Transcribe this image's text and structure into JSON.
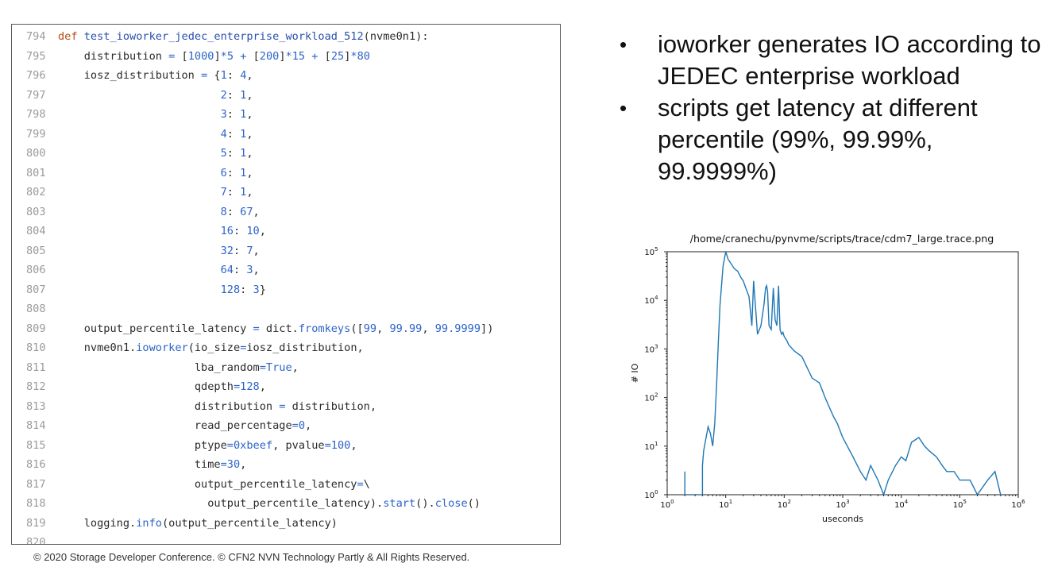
{
  "code": {
    "lines": [
      {
        "n": "794",
        "t": [
          [
            "kw",
            "def "
          ],
          [
            "fn",
            "test_ioworker_jedec_enterprise_workload_512"
          ],
          [
            "",
            "(nvme0n1):"
          ]
        ]
      },
      {
        "n": "795",
        "t": [
          [
            "",
            "    distribution "
          ],
          [
            "op",
            "="
          ],
          [
            "",
            " ["
          ],
          [
            "num",
            "1000"
          ],
          [
            "",
            "]"
          ],
          [
            "op",
            "*"
          ],
          [
            "num",
            "5"
          ],
          [
            "",
            " "
          ],
          [
            "op",
            "+"
          ],
          [
            "",
            " ["
          ],
          [
            "num",
            "200"
          ],
          [
            "",
            "]"
          ],
          [
            "op",
            "*"
          ],
          [
            "num",
            "15"
          ],
          [
            "",
            " "
          ],
          [
            "op",
            "+"
          ],
          [
            "",
            " ["
          ],
          [
            "num",
            "25"
          ],
          [
            "",
            "]"
          ],
          [
            "op",
            "*"
          ],
          [
            "num",
            "80"
          ]
        ]
      },
      {
        "n": "796",
        "t": [
          [
            "",
            "    iosz_distribution "
          ],
          [
            "op",
            "="
          ],
          [
            "",
            " {"
          ],
          [
            "num",
            "1"
          ],
          [
            "",
            ": "
          ],
          [
            "num",
            "4"
          ],
          [
            "",
            ","
          ]
        ]
      },
      {
        "n": "797",
        "t": [
          [
            "",
            "                         "
          ],
          [
            "num",
            "2"
          ],
          [
            "",
            ": "
          ],
          [
            "num",
            "1"
          ],
          [
            "",
            ","
          ]
        ]
      },
      {
        "n": "798",
        "t": [
          [
            "",
            "                         "
          ],
          [
            "num",
            "3"
          ],
          [
            "",
            ": "
          ],
          [
            "num",
            "1"
          ],
          [
            "",
            ","
          ]
        ]
      },
      {
        "n": "799",
        "t": [
          [
            "",
            "                         "
          ],
          [
            "num",
            "4"
          ],
          [
            "",
            ": "
          ],
          [
            "num",
            "1"
          ],
          [
            "",
            ","
          ]
        ]
      },
      {
        "n": "800",
        "t": [
          [
            "",
            "                         "
          ],
          [
            "num",
            "5"
          ],
          [
            "",
            ": "
          ],
          [
            "num",
            "1"
          ],
          [
            "",
            ","
          ]
        ]
      },
      {
        "n": "801",
        "t": [
          [
            "",
            "                         "
          ],
          [
            "num",
            "6"
          ],
          [
            "",
            ": "
          ],
          [
            "num",
            "1"
          ],
          [
            "",
            ","
          ]
        ]
      },
      {
        "n": "802",
        "t": [
          [
            "",
            "                         "
          ],
          [
            "num",
            "7"
          ],
          [
            "",
            ": "
          ],
          [
            "num",
            "1"
          ],
          [
            "",
            ","
          ]
        ]
      },
      {
        "n": "803",
        "t": [
          [
            "",
            "                         "
          ],
          [
            "num",
            "8"
          ],
          [
            "",
            ": "
          ],
          [
            "num",
            "67"
          ],
          [
            "",
            ","
          ]
        ]
      },
      {
        "n": "804",
        "t": [
          [
            "",
            "                         "
          ],
          [
            "num",
            "16"
          ],
          [
            "",
            ": "
          ],
          [
            "num",
            "10"
          ],
          [
            "",
            ","
          ]
        ]
      },
      {
        "n": "805",
        "t": [
          [
            "",
            "                         "
          ],
          [
            "num",
            "32"
          ],
          [
            "",
            ": "
          ],
          [
            "num",
            "7"
          ],
          [
            "",
            ","
          ]
        ]
      },
      {
        "n": "806",
        "t": [
          [
            "",
            "                         "
          ],
          [
            "num",
            "64"
          ],
          [
            "",
            ": "
          ],
          [
            "num",
            "3"
          ],
          [
            "",
            ","
          ]
        ]
      },
      {
        "n": "807",
        "t": [
          [
            "",
            "                         "
          ],
          [
            "num",
            "128"
          ],
          [
            "",
            ": "
          ],
          [
            "num",
            "3"
          ],
          [
            "",
            "}"
          ]
        ]
      },
      {
        "n": "808",
        "t": []
      },
      {
        "n": "809",
        "t": [
          [
            "",
            "    output_percentile_latency "
          ],
          [
            "op",
            "="
          ],
          [
            "",
            " dict."
          ],
          [
            "meth",
            "fromkeys"
          ],
          [
            "",
            "(["
          ],
          [
            "num",
            "99"
          ],
          [
            "",
            ", "
          ],
          [
            "num",
            "99.99"
          ],
          [
            "",
            ", "
          ],
          [
            "num",
            "99.9999"
          ],
          [
            "",
            "])"
          ]
        ]
      },
      {
        "n": "810",
        "t": [
          [
            "",
            "    nvme0n1."
          ],
          [
            "meth",
            "ioworker"
          ],
          [
            "",
            "(io_size"
          ],
          [
            "op",
            "="
          ],
          [
            "",
            "iosz_distribution,"
          ]
        ]
      },
      {
        "n": "811",
        "t": [
          [
            "",
            "                     lba_random"
          ],
          [
            "op",
            "="
          ],
          [
            "bi",
            "True"
          ],
          [
            "",
            ","
          ]
        ]
      },
      {
        "n": "812",
        "t": [
          [
            "",
            "                     qdepth"
          ],
          [
            "op",
            "="
          ],
          [
            "num",
            "128"
          ],
          [
            "",
            ","
          ]
        ]
      },
      {
        "n": "813",
        "t": [
          [
            "",
            "                     distribution "
          ],
          [
            "op",
            "="
          ],
          [
            "",
            " distribution,"
          ]
        ]
      },
      {
        "n": "814",
        "t": [
          [
            "",
            "                     read_percentage"
          ],
          [
            "op",
            "="
          ],
          [
            "num",
            "0"
          ],
          [
            "",
            ","
          ]
        ]
      },
      {
        "n": "815",
        "t": [
          [
            "",
            "                     ptype"
          ],
          [
            "op",
            "="
          ],
          [
            "num",
            "0xbeef"
          ],
          [
            "",
            ", pvalue"
          ],
          [
            "op",
            "="
          ],
          [
            "num",
            "100"
          ],
          [
            "",
            ","
          ]
        ]
      },
      {
        "n": "816",
        "t": [
          [
            "",
            "                     time"
          ],
          [
            "op",
            "="
          ],
          [
            "num",
            "30"
          ],
          [
            "",
            ","
          ]
        ]
      },
      {
        "n": "817",
        "t": [
          [
            "",
            "                     output_percentile_latency"
          ],
          [
            "op",
            "="
          ],
          [
            "",
            "\\"
          ]
        ]
      },
      {
        "n": "818",
        "t": [
          [
            "",
            "                       output_percentile_latency)."
          ],
          [
            "meth",
            "start"
          ],
          [
            "",
            "()."
          ],
          [
            "meth",
            "close"
          ],
          [
            "",
            "()"
          ]
        ]
      },
      {
        "n": "819",
        "t": [
          [
            "",
            "    logging."
          ],
          [
            "meth",
            "info"
          ],
          [
            "",
            "(output_percentile_latency)"
          ]
        ]
      },
      {
        "n": "820",
        "t": []
      }
    ]
  },
  "bullets": [
    "ioworker generates IO according to JEDEC enterprise workload",
    "scripts get latency at different percentile (99%, 99.99%, 99.9999%)"
  ],
  "bullet_glyph": "•",
  "footer": "© 2020 Storage Developer Conference. © CFN2 NVN Technology Partly & All Rights Reserved.",
  "chart_data": {
    "type": "line",
    "title": "/home/cranechu/pynvme/scripts/trace/cdm7_large.trace.png",
    "xlabel": "useconds",
    "ylabel": "# IO",
    "xscale": "log",
    "yscale": "log",
    "xlim": [
      1,
      100000
    ],
    "ylim": [
      1,
      100000
    ],
    "grid": false,
    "color": "#1f77b4",
    "xticks": [
      "10^0",
      "10^1",
      "10^2",
      "10^3",
      "10^4",
      "10^5",
      "10^6"
    ],
    "yticks": [
      "10^0",
      "10^1",
      "10^2",
      "10^3",
      "10^4",
      "10^5"
    ],
    "series": [
      {
        "x": [
          2,
          2,
          2,
          4,
          4,
          4.2,
          5,
          5.5,
          6,
          6.5,
          7,
          7.5,
          8,
          9,
          10,
          11,
          12,
          14,
          16,
          18,
          20,
          22,
          25,
          28,
          30,
          35,
          40,
          45,
          48,
          50,
          52,
          55,
          60,
          65,
          70,
          75,
          80,
          85,
          90,
          95,
          100,
          110,
          120,
          150,
          200,
          250,
          300,
          400,
          500,
          600,
          700,
          800,
          1000,
          1200,
          1500,
          2000,
          2500,
          3000,
          4000,
          5000,
          6000,
          8000,
          10000,
          12000,
          15000,
          20000,
          25000,
          30000,
          40000,
          50000,
          60000,
          80000,
          100000,
          150000,
          200000,
          300000,
          400000,
          500000
        ],
        "y": [
          1,
          3,
          1,
          1,
          4,
          8,
          25,
          18,
          10,
          30,
          200,
          1500,
          8000,
          50000,
          100000,
          70000,
          60000,
          45000,
          40000,
          30000,
          25000,
          18000,
          12000,
          3000,
          25000,
          2000,
          3000,
          8000,
          18000,
          20000,
          15000,
          3000,
          2500,
          18000,
          4000,
          3000,
          20000,
          2500,
          2000,
          2200,
          1800,
          1500,
          1200,
          900,
          700,
          400,
          250,
          200,
          100,
          60,
          40,
          30,
          15,
          10,
          6,
          3,
          2,
          4,
          2,
          1,
          2,
          4,
          6,
          5,
          12,
          15,
          10,
          8,
          6,
          4,
          3,
          3,
          2,
          2,
          1,
          2,
          3,
          1
        ]
      }
    ]
  }
}
